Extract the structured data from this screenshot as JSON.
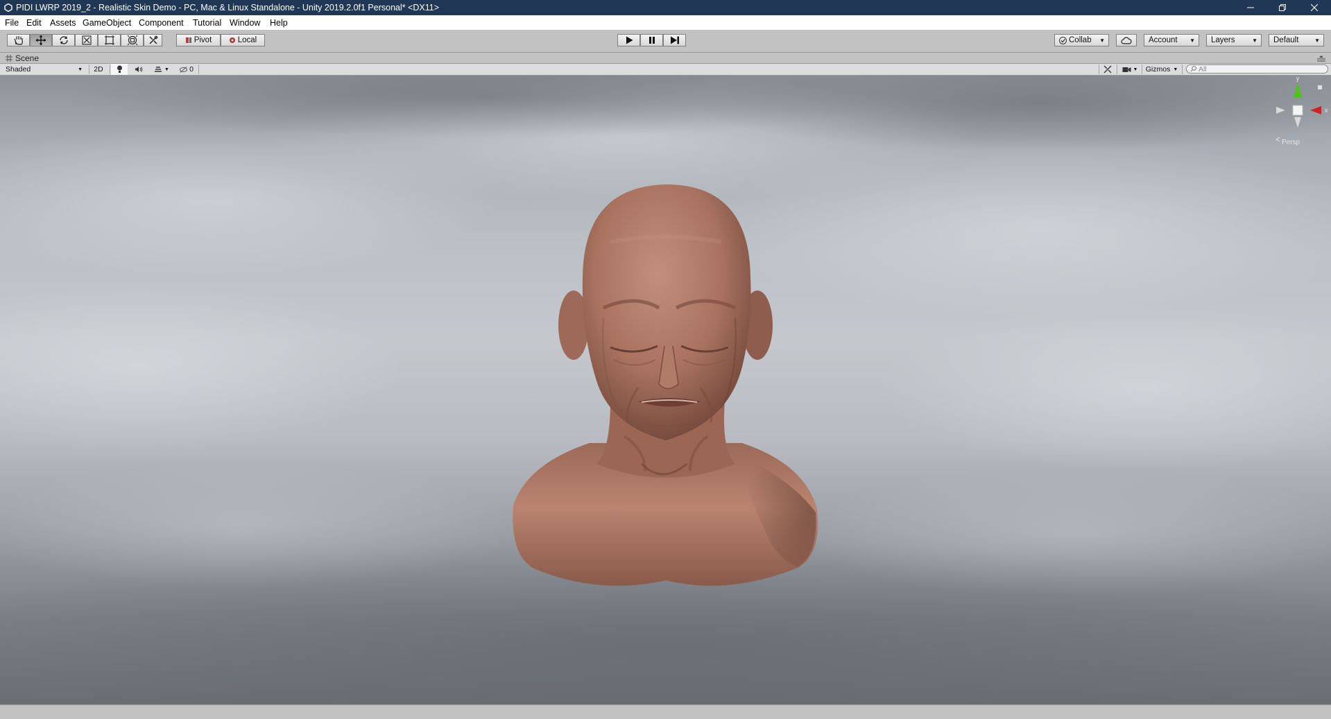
{
  "window": {
    "title": "PIDI LWRP 2019_2 - Realistic Skin Demo - PC, Mac & Linux Standalone - Unity 2019.2.0f1 Personal* <DX11>",
    "controls": [
      "minimize-icon",
      "restore-icon",
      "close-icon"
    ]
  },
  "menu": {
    "items": [
      "File",
      "Edit",
      "Assets",
      "GameObject",
      "Component",
      "Tutorial",
      "Window",
      "Help"
    ]
  },
  "toolbar": {
    "tools": [
      "hand-tool-icon",
      "move-tool-icon",
      "rotate-tool-icon",
      "scale-tool-icon",
      "rect-tool-icon",
      "transform-tool-icon",
      "custom-tool-icon"
    ],
    "active_tool": "move-tool-icon",
    "pivot_label": "Pivot",
    "local_label": "Local",
    "playback": [
      "play-icon",
      "pause-icon",
      "step-icon"
    ],
    "collab_label": "Collab",
    "account_label": "Account",
    "layers_label": "Layers",
    "layout_label": "Default"
  },
  "scene": {
    "tab_label": "Scene",
    "shading_mode": "Shaded",
    "mode_2d_label": "2D",
    "hidden_count": "0",
    "gizmos_label": "Gizmos",
    "search_placeholder": "All",
    "gizmo_axes": {
      "y": "y",
      "x": "x"
    },
    "projection_label": "Persp"
  },
  "colors": {
    "titlebar": "#203856",
    "toolbar_bg": "#c2c2c2",
    "axis_x": "#d62020",
    "axis_y": "#4ec21a",
    "skin": "#b07a66"
  }
}
